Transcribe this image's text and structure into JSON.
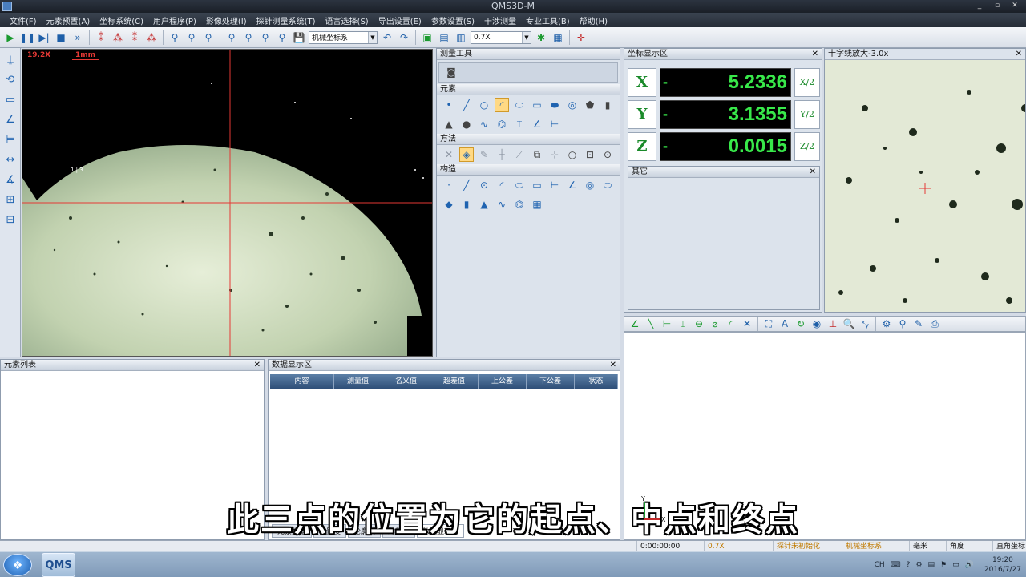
{
  "window": {
    "title": "QMS3D-M",
    "controls": [
      "_",
      "▫",
      "✕"
    ]
  },
  "menu": [
    "文件(F)",
    "元素预置(A)",
    "坐标系统(C)",
    "用户程序(P)",
    "影像处理(I)",
    "探针测量系统(T)",
    "语言选择(S)",
    "导出设置(E)",
    "参数设置(S)",
    "干涉测量",
    "专业工具(B)",
    "帮助(H)"
  ],
  "toolbar": {
    "coord_system": "机械坐标系",
    "zoom": "0.7X"
  },
  "camera": {
    "zoom_label": "19.2X",
    "scale_label": "1mm",
    "marker": "1 | 3"
  },
  "toolpanel": {
    "measure_tools": "测量工具",
    "elements": "元素",
    "methods": "方法",
    "construct": "构造"
  },
  "coord_panel": {
    "title": "坐标显示区",
    "other_title": "其它",
    "rows": [
      {
        "axis": "X",
        "sign": "-",
        "value": "5.2336",
        "half": "X/2"
      },
      {
        "axis": "Y",
        "sign": "-",
        "value": "3.1355",
        "half": "Y/2"
      },
      {
        "axis": "Z",
        "sign": "-",
        "value": "0.0015",
        "half": "Z/2"
      }
    ]
  },
  "crosshair_panel": {
    "title": "十字线放大-3.0x"
  },
  "element_list": {
    "title": "元素列表"
  },
  "data_panel": {
    "title": "数据显示区",
    "columns": [
      "内容",
      "测量值",
      "名义值",
      "超差值",
      "上公差",
      "下公差",
      "状态"
    ],
    "tabs": [
      "元素数据",
      "位置度",
      "轮廓度",
      "对称度",
      "数据显示区"
    ]
  },
  "status_bar": {
    "time": "0:00:00:00",
    "zoom": "0.7X",
    "probe": "探针未初始化",
    "coord": "机械坐标系",
    "unit": "毫米",
    "angle": "角度",
    "cs_type": "直角坐标"
  },
  "taskbar": {
    "app_label": "QMS",
    "lang": "CH",
    "time": "19:20",
    "date": "2016/7/27"
  },
  "subtitle": "此三点的位置为它的起点、中点和终点",
  "colors": {
    "crosshair": "#e53935",
    "digits": "#38e84a",
    "axis_letter": "#1a8a2a"
  }
}
